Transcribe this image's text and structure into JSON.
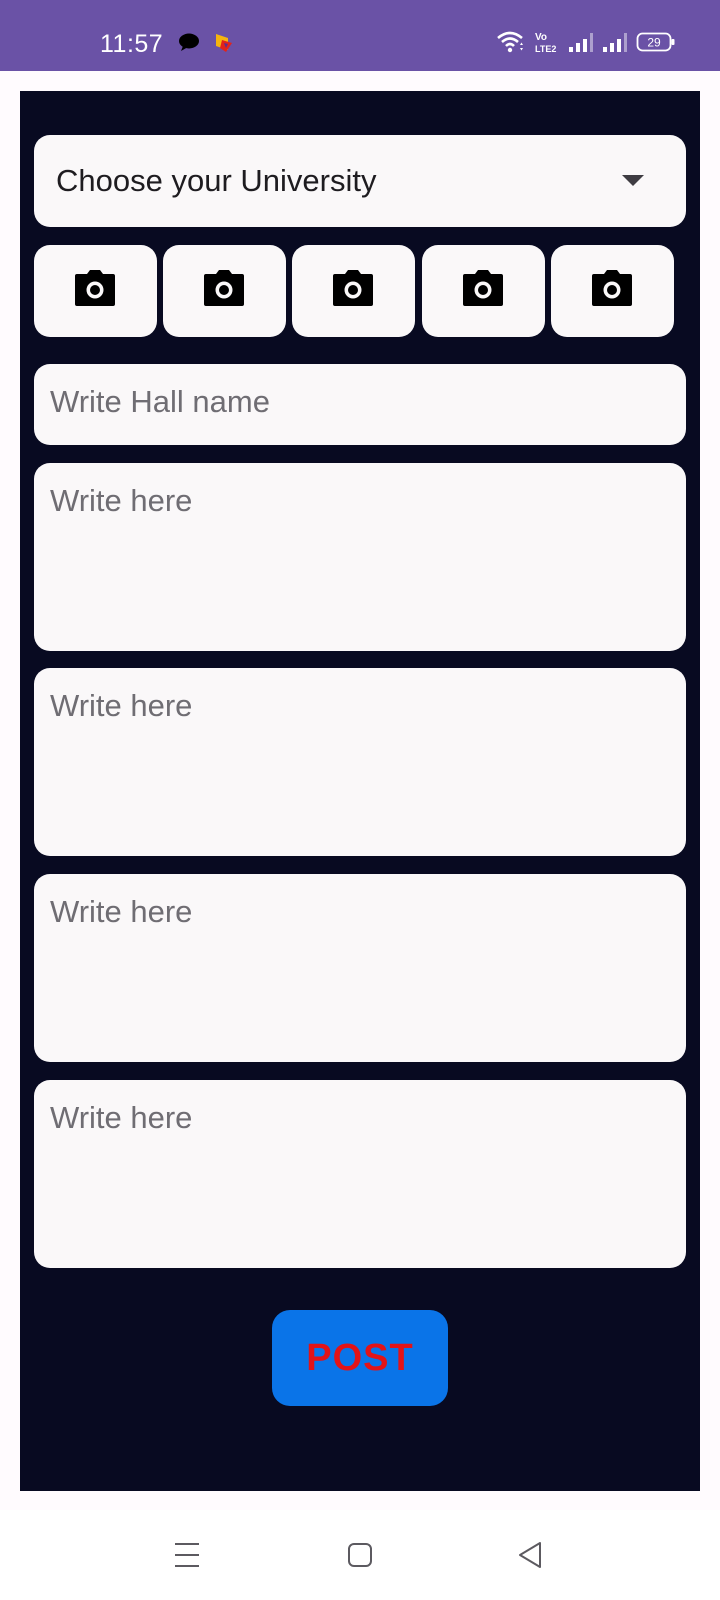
{
  "status_bar": {
    "time": "11:57",
    "battery": "29",
    "icons": [
      "chat-notification-icon",
      "app-notification-icon",
      "wifi-icon",
      "volte-icon",
      "signal-icon",
      "signal-icon",
      "battery-icon"
    ]
  },
  "form": {
    "university_dropdown": {
      "label": "Choose your University",
      "icon": "dropdown-arrow-icon"
    },
    "photo_buttons": [
      {
        "icon": "camera-icon"
      },
      {
        "icon": "camera-icon"
      },
      {
        "icon": "camera-icon"
      },
      {
        "icon": "camera-icon"
      },
      {
        "icon": "camera-icon"
      }
    ],
    "hall_name": {
      "placeholder": "Write Hall name"
    },
    "text_fields": [
      {
        "placeholder": "Write here"
      },
      {
        "placeholder": "Write here"
      },
      {
        "placeholder": "Write here"
      },
      {
        "placeholder": "Write here"
      }
    ],
    "post_button": {
      "label": "POST"
    }
  },
  "navigation": {
    "items": [
      "menu-icon",
      "home-icon",
      "back-icon"
    ]
  },
  "colors": {
    "status_bar": "#6a52a6",
    "panel_background": "#080a21",
    "field_background": "#faf8f9",
    "post_button": "#0a74e8",
    "post_label": "#e31317"
  }
}
